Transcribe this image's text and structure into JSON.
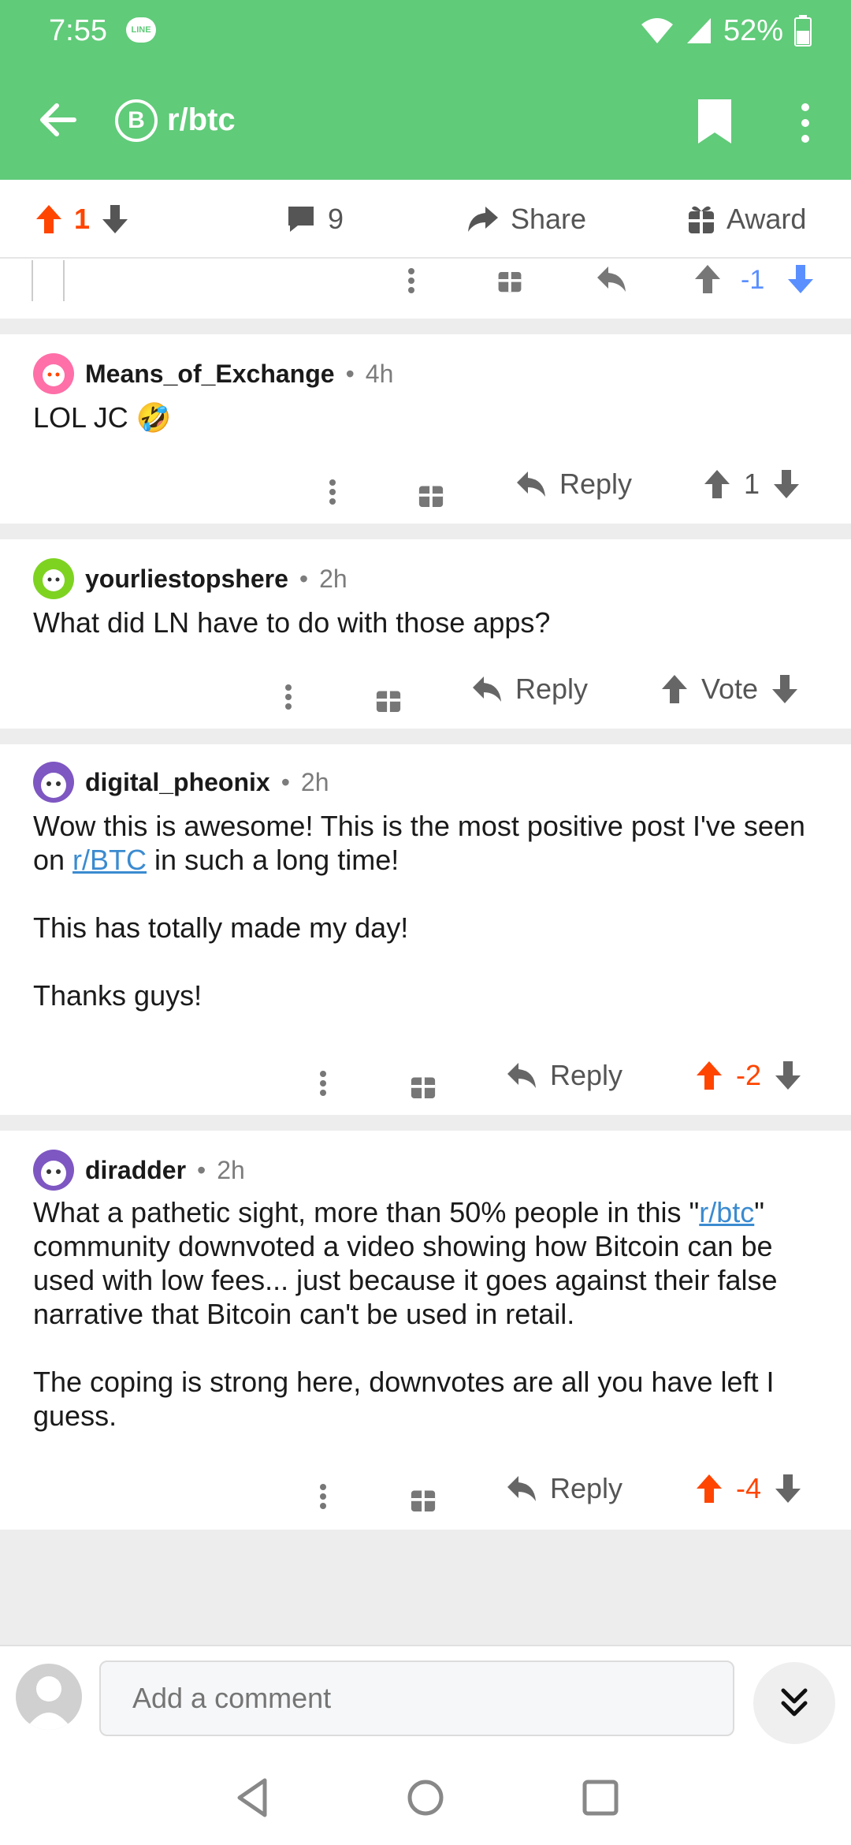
{
  "status_bar": {
    "time": "7:55",
    "line_badge": "LINE",
    "battery": "52%"
  },
  "app_bar": {
    "sub_icon_glyph": "B",
    "subreddit": "r/btc"
  },
  "post_actions": {
    "vote_count": "1",
    "comment_count": "9",
    "share_label": "Share",
    "award_label": "Award"
  },
  "partial_comment": {
    "score": "-1"
  },
  "comments": [
    {
      "user": "Means_of_Exchange",
      "time": "4h",
      "paragraphs": [
        "LOL JC 🤣"
      ],
      "reply_label": "Reply",
      "score": "1"
    },
    {
      "user": "yourliestopshere",
      "time": "2h",
      "paragraphs": [
        "What did LN have to do with those apps?"
      ],
      "reply_label": "Reply",
      "score": "Vote"
    },
    {
      "user": "digital_pheonix",
      "time": "2h",
      "p1_before": "Wow this is awesome! This is the most positive post I've seen on ",
      "p1_link": "r/BTC",
      "p1_after": " in such a long time!",
      "p2": "This has totally made my day!",
      "p3": "Thanks guys!",
      "reply_label": "Reply",
      "score": "-2"
    },
    {
      "user": "diradder",
      "time": "2h",
      "p1_before": "What a pathetic sight, more than 50% people in this \"",
      "p1_link": "r/btc",
      "p1_after": "\" community downvoted a video showing how Bitcoin can be used with low fees... just because it goes against their false narrative that Bitcoin can't be used in retail.",
      "p2": "The coping is strong here, downvotes are all you have left I guess.",
      "reply_label": "Reply",
      "score": "-4"
    }
  ],
  "composer": {
    "placeholder": "Add a comment"
  },
  "colors": {
    "app_green": "#60cb79",
    "upvote_orange": "#ff4500",
    "downvote_blue": "#5a8fff",
    "link_blue": "#3b8bd0"
  }
}
